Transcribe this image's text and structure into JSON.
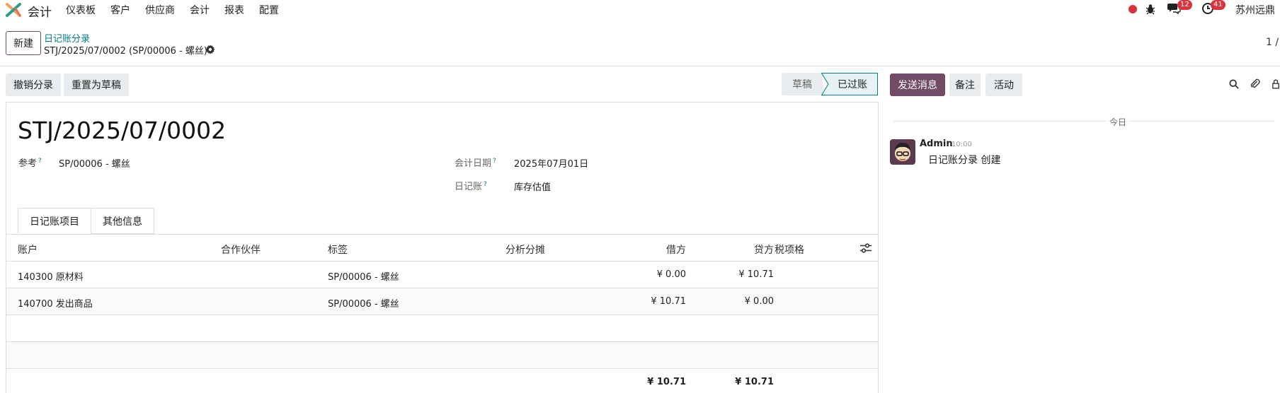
{
  "nav": {
    "app_name": "会计",
    "menu": [
      "仪表板",
      "客户",
      "供应商",
      "会计",
      "报表",
      "配置"
    ],
    "messages_count": "12",
    "activities_count": "41",
    "company": "苏州远鼎"
  },
  "control": {
    "new_label": "新建",
    "breadcrumb_parent": "日记账分录",
    "breadcrumb_current": "STJ/2025/07/0002 (SP/00006 - 螺丝)",
    "pager": "1 /"
  },
  "actions": {
    "cancel_entry": "撤销分录",
    "reset_draft": "重置为草稿"
  },
  "status": {
    "draft": "草稿",
    "posted": "已过账"
  },
  "chatter_buttons": {
    "send": "发送消息",
    "note": "备注",
    "activity": "活动"
  },
  "form": {
    "title": "STJ/2025/07/0002",
    "ref_label": "参考",
    "ref_value": "SP/00006 - 螺丝",
    "date_label": "会计日期",
    "date_value": "2025年07月01日",
    "journal_label": "日记账",
    "journal_value": "库存估值",
    "help_mark": "?"
  },
  "tabs": [
    "日记账项目",
    "其他信息"
  ],
  "table": {
    "headers": {
      "account": "账户",
      "partner": "合作伙伴",
      "label": "标签",
      "analytic": "分析分摊",
      "debit": "借方",
      "credit": "贷方",
      "tax": "税项格"
    },
    "rows": [
      {
        "account": "140300 原材料",
        "label": "SP/00006 - 螺丝",
        "debit": "¥ 0.00",
        "credit": "¥ 10.71"
      },
      {
        "account": "140700 发出商品",
        "label": "SP/00006 - 螺丝",
        "debit": "¥ 10.71",
        "credit": "¥ 0.00"
      }
    ],
    "total_debit": "¥ 10.71",
    "total_credit": "¥ 10.71"
  },
  "chatter": {
    "today": "今日",
    "author": "Admin",
    "time": "10:00",
    "message": "日记账分录 创建"
  },
  "colors": {
    "brand": "#714b67",
    "link": "#017e84",
    "badge": "#d9343e"
  }
}
